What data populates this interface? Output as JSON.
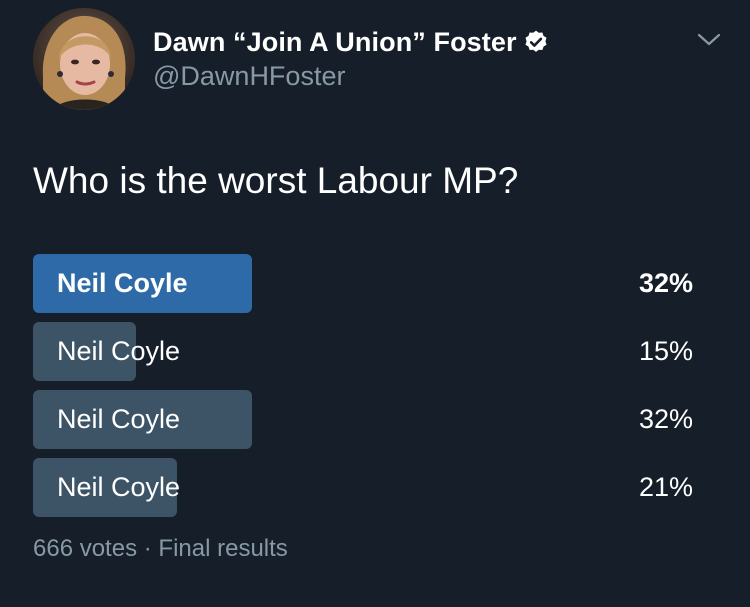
{
  "author": {
    "display_name": "Dawn “Join A Union” Foster",
    "handle": "@DawnHFoster",
    "verified": true,
    "avatar": "user-avatar-photo"
  },
  "icons": {
    "verified": "verified-badge-icon",
    "more": "chevron-down-icon"
  },
  "poll": {
    "question": "Who is the worst Labour MP?",
    "options": [
      {
        "label": "Neil Coyle",
        "percent_text": "32%",
        "percent": 32,
        "winner": true
      },
      {
        "label": "Neil Coyle",
        "percent_text": "15%",
        "percent": 15,
        "winner": false
      },
      {
        "label": "Neil Coyle",
        "percent_text": "32%",
        "percent": 32,
        "winner": false
      },
      {
        "label": "Neil Coyle",
        "percent_text": "21%",
        "percent": 21,
        "winner": false
      }
    ],
    "votes": "666 votes",
    "separator": "·",
    "status": "Final results"
  },
  "colors": {
    "background": "#151e29",
    "winner_bar": "#2e6aa7",
    "bar": "#3d5466",
    "secondary_text": "#8899a6",
    "verified_badge": "#ffffff"
  }
}
